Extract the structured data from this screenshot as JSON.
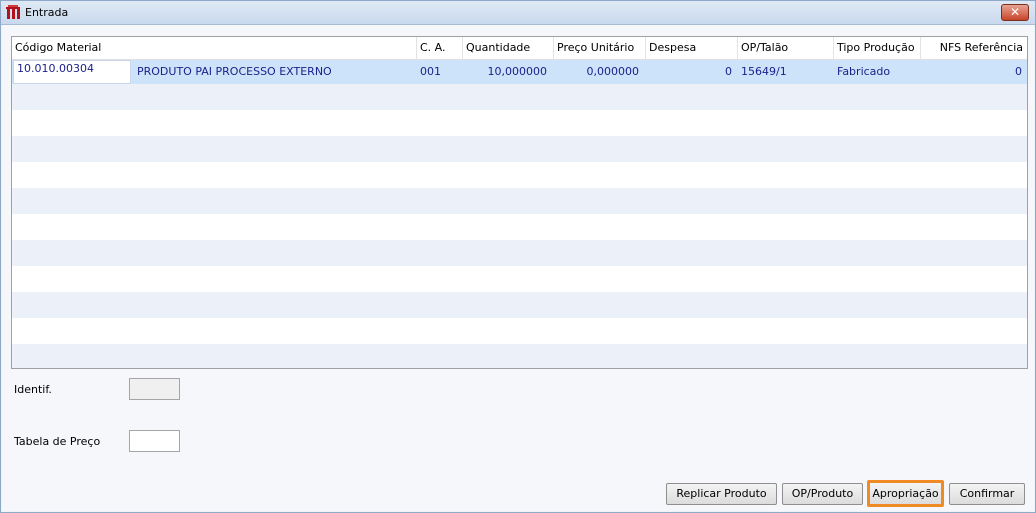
{
  "window": {
    "title": "Entrada",
    "close_label": "✕"
  },
  "grid": {
    "columns": [
      "Código Material",
      "",
      "C. A.",
      "Quantidade",
      "Preço Unitário",
      "Despesa",
      "OP/Talão",
      "Tipo Produção",
      "NFS Referência"
    ],
    "rows": [
      {
        "code": "10.010.00304",
        "description": "PRODUTO PAI PROCESSO EXTERNO",
        "ca": "001",
        "quantidade": "10,000000",
        "preco_unitario": "0,000000",
        "despesa": "0",
        "op_talao": "15649/1",
        "tipo_producao": "Fabricado",
        "nfs_referencia": "0"
      }
    ]
  },
  "form": {
    "identif_label": "Identif.",
    "identif_value": "",
    "tabela_preco_label": "Tabela de Preço",
    "tabela_preco_value": ""
  },
  "buttons": {
    "replicar_produto": "Replicar Produto",
    "op_produto": "OP/Produto",
    "apropriacao": "Apropriação",
    "confirmar": "Confirmar"
  },
  "colors": {
    "selected_row": "#cde3f9",
    "alt_row": "#ecf1f9",
    "focus_outline": "#f08a24",
    "cell_text": "#1a1f8a"
  }
}
